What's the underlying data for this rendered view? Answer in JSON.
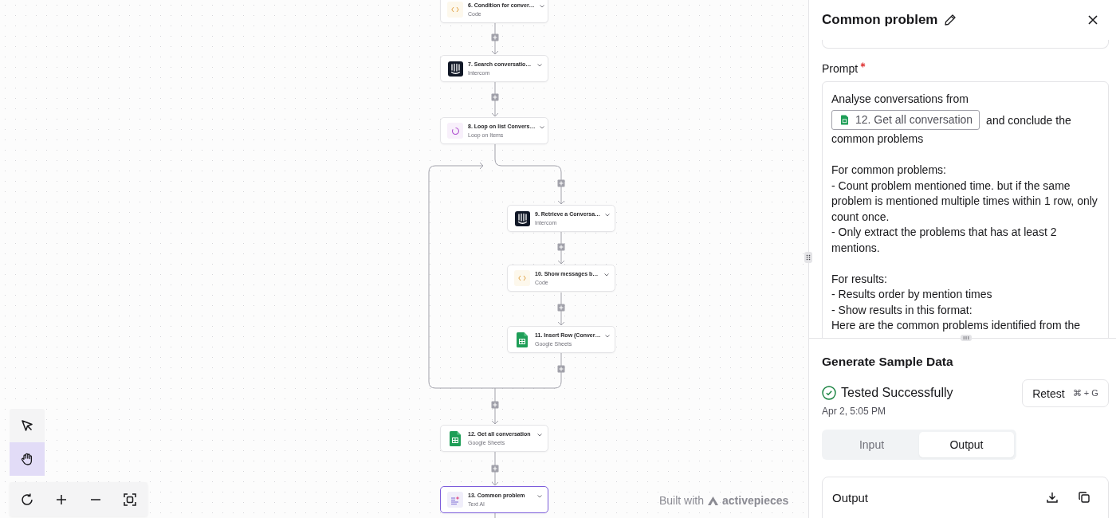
{
  "canvas": {
    "nodes": [
      {
        "title": "6. Condition for conver…",
        "subtitle": "Code",
        "kind": "code",
        "selected": false
      },
      {
        "title": "7. Search conversatio…",
        "subtitle": "Intercom",
        "kind": "intercom",
        "selected": false
      },
      {
        "title": "8. Loop on list Convers…",
        "subtitle": "Loop on Items",
        "kind": "loop",
        "selected": false,
        "children": [
          {
            "title": "9. Retrieve a Conversa…",
            "subtitle": "Intercom",
            "kind": "intercom",
            "selected": false
          },
          {
            "title": "10. Show messages b…",
            "subtitle": "Code",
            "kind": "code",
            "selected": false
          },
          {
            "title": "11. Insert Row (Conver…",
            "subtitle": "Google Sheets",
            "kind": "sheets",
            "selected": false
          }
        ]
      },
      {
        "title": "12. Get all conversation",
        "subtitle": "Google Sheets",
        "kind": "sheets",
        "selected": false
      },
      {
        "title": "13. Common problem",
        "subtitle": "Text AI",
        "kind": "ai",
        "selected": true
      }
    ],
    "tools": [
      {
        "kind": "pointer",
        "selected": false
      },
      {
        "kind": "hand",
        "selected": true
      }
    ],
    "branding": {
      "prefix": "Built with",
      "name": "activepieces"
    }
  },
  "panel": {
    "title": "Common problem",
    "prompt": {
      "label": "Prompt",
      "required": true,
      "intro": "Analyse conversations from",
      "chip": {
        "label": "12. Get all conversation",
        "kind": "sheets"
      },
      "after_chip": "and conclude the",
      "next_line": "common problems",
      "blocks": [
        [
          "For common problems:",
          "- Count problem mentioned time. but if the same problem is mentioned multiple times within 1 row, only count once.",
          "- Only extract the problems that has at least 2 mentions."
        ],
        [
          "For results:",
          "- Results order by mention times",
          "- Show results in this format:",
          "Here are the common problems identified from the"
        ]
      ]
    },
    "sample": {
      "title": "Generate Sample Data",
      "status": "Tested Successfully",
      "tested": true,
      "timestamp": "Apr 2, 5:05 PM",
      "retest": "Retest",
      "shortcut": "⌘ + G",
      "tabs": [
        {
          "label": "Input",
          "selected": false
        },
        {
          "label": "Output",
          "selected": true
        }
      ],
      "output_title": "Output"
    }
  }
}
